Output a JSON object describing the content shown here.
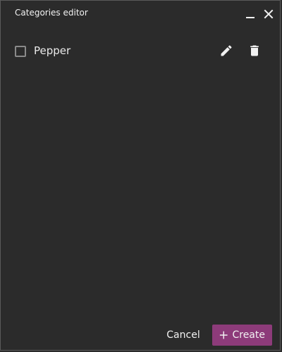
{
  "window": {
    "title": "Categories editor"
  },
  "categories": [
    {
      "label": "Pepper",
      "checked": false
    }
  ],
  "footer": {
    "cancel_label": "Cancel",
    "create_label": "Create"
  },
  "icons": {
    "minimize": "minimize-icon",
    "close": "close-icon",
    "edit": "pencil-icon",
    "delete": "trash-icon",
    "add": "plus-icon"
  },
  "colors": {
    "background": "#2b2b2b",
    "accent": "#8d3b7a",
    "text": "#f2f2f2"
  }
}
